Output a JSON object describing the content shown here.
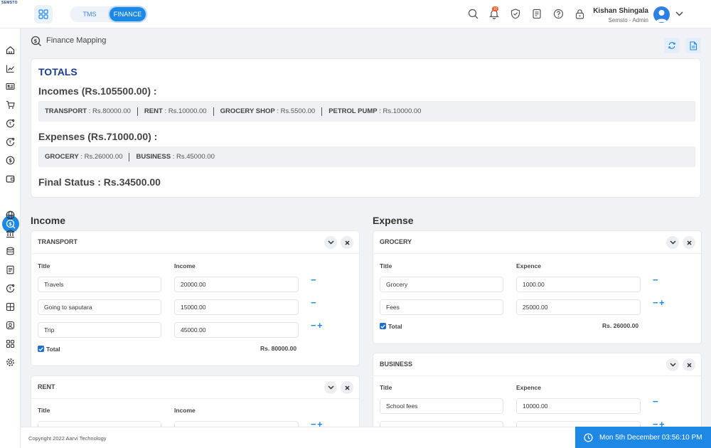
{
  "brand": {
    "logo_text": "SEMSTO"
  },
  "topbar": {
    "tabs": [
      {
        "label": "TMS"
      },
      {
        "label": "FINANCE"
      }
    ],
    "notification_count": "10",
    "user": {
      "name": "Kishan Shingala",
      "role": "Semsto - Admin"
    }
  },
  "page": {
    "title": "Finance Mapping"
  },
  "totals": {
    "title": "TOTALS",
    "incomes_heading": "Incomes (Rs.105500.00) :",
    "income_items": [
      {
        "label": "TRANSPORT",
        "value": ": Rs.80000.00"
      },
      {
        "label": "RENT",
        "value": ": Rs.10000.00"
      },
      {
        "label": "GROCERY SHOP",
        "value": ": Rs.5500.00"
      },
      {
        "label": "PETROL PUMP",
        "value": ": Rs.10000.00"
      }
    ],
    "expenses_heading": "Expenses (Rs.71000.00) :",
    "expense_items": [
      {
        "label": "GROCERY",
        "value": ": Rs.26000.00"
      },
      {
        "label": "BUSINESS",
        "value": ": Rs.45000.00"
      }
    ],
    "final_status": "Final Status : Rs.34500.00"
  },
  "income": {
    "heading": "Income",
    "transport": {
      "name": "TRANSPORT",
      "title_label": "Title",
      "value_label": "Income",
      "rows": [
        {
          "title": "Travels",
          "value": "20000.00"
        },
        {
          "title": "Going to saputara",
          "value": "15000.00"
        },
        {
          "title": "Trip",
          "value": "45000.00"
        }
      ],
      "total_label": "Total",
      "total_value": "Rs. 80000.00"
    },
    "rent": {
      "name": "RENT",
      "title_label": "Title",
      "value_label": "Income"
    }
  },
  "expense": {
    "heading": "Expense",
    "grocery": {
      "name": "GROCERY",
      "title_label": "Title",
      "value_label": "Expence",
      "rows": [
        {
          "title": "Grocery",
          "value": "1000.00"
        },
        {
          "title": "Fees",
          "value": "25000.00"
        }
      ],
      "total_label": "Total",
      "total_value": "Rs. 26000.00"
    },
    "business": {
      "name": "BUSINESS",
      "title_label": "Title",
      "value_label": "Expence",
      "rows": [
        {
          "title": "School fees",
          "value": "10000.00"
        }
      ]
    }
  },
  "footer": {
    "copyright": "Copyright 2022 Aarvi Technology"
  },
  "clock": {
    "datetime": "Mon 5th December 03:56:10 PM"
  },
  "colors": {
    "accent": "#1e88e5",
    "heading_blue": "#1a3b8f",
    "background": "#f1f2f5"
  }
}
